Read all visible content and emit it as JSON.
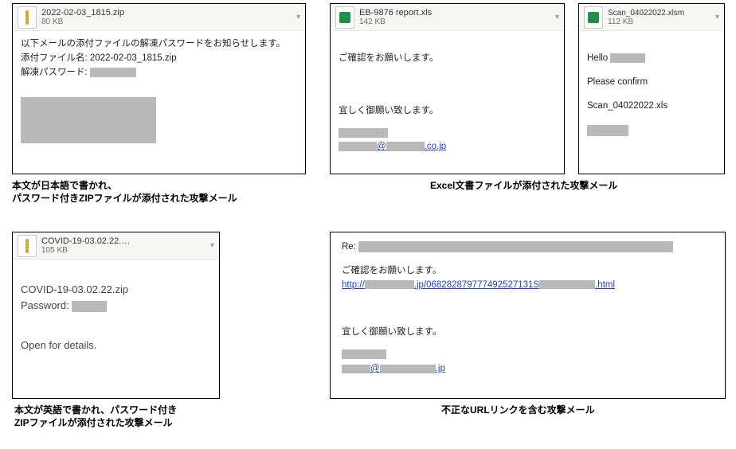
{
  "panels": {
    "p1": {
      "attachment": {
        "name": "2022-02-03_1815.zip",
        "size": "80 KB"
      },
      "body": {
        "line1": "以下メールの添付ファイルの解凍パスワードをお知らせします。",
        "line2_label": "添付ファイル名: ",
        "line2_value": "2022-02-03_1815.zip",
        "line3_label": "解凍パスワード: "
      },
      "caption_l1": "本文が日本語で書かれ、",
      "caption_l2": "パスワード付きZIPファイルが添付された攻撃メール"
    },
    "p2": {
      "attachment": {
        "name": "EB-9876 report.xls",
        "size": "142 KB"
      },
      "body": {
        "line1": "ご確認をお願いします。",
        "line2": "宜しく御願い致します。",
        "sig_domain": ".co.jp"
      }
    },
    "p3": {
      "attachment": {
        "name": "Scan_04022022.xlsm",
        "size": "112 KB"
      },
      "body": {
        "line1": "Hello",
        "line2": "Please confirm",
        "line3": "Scan_04022022.xls"
      }
    },
    "caption_p23": "Excel文書ファイルが添付された攻撃メール",
    "p4": {
      "attachment": {
        "name": "COVID-19-03.02.22.…",
        "size": "105 KB"
      },
      "body": {
        "line1": "COVID-19-03.02.22.zip",
        "line2_label": "Password:",
        "line3": "Open for details."
      },
      "caption_l1": "本文が英語で書かれ、パスワード付き",
      "caption_l2": "ZIPファイルが添付された攻撃メール"
    },
    "p5": {
      "body": {
        "subject_prefix": "Re:",
        "line1": "ご確認をお願いします。",
        "url_proto": "http://",
        "url_mid": ".jp/068282879777492527131S",
        "url_end": ".html",
        "line2": "宜しく御願い致します。",
        "sig_at": "@",
        "sig_domain": ".jp"
      },
      "caption": "不正なURLリンクを含む攻撃メール"
    }
  }
}
